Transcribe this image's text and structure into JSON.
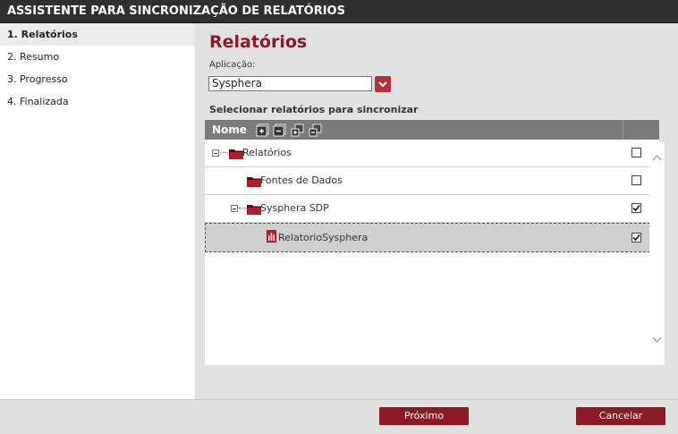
{
  "window": {
    "title": "ASSISTENTE PARA SINCRONIZAÇÃO DE RELATÓRIOS"
  },
  "steps": [
    {
      "label": "1. Relatórios",
      "active": true
    },
    {
      "label": "2. Resumo",
      "active": false
    },
    {
      "label": "3. Progresso",
      "active": false
    },
    {
      "label": "4. Finalizada",
      "active": false
    }
  ],
  "main": {
    "heading": "Relatórios",
    "application_label": "Aplicação:",
    "application_value": "Sysphera",
    "select_label": "Selecionar relatórios para sincronizar"
  },
  "grid": {
    "column_name": "Nome",
    "rows": [
      {
        "label": "Relatórios",
        "type": "folder",
        "checked": false
      },
      {
        "label": "Fontes de Dados",
        "type": "folder",
        "checked": false
      },
      {
        "label": "Sysphera SDP",
        "type": "folder",
        "checked": true
      },
      {
        "label": "RelatorioSysphera",
        "type": "report",
        "checked": true
      }
    ]
  },
  "buttons": {
    "next": "Próximo",
    "cancel": "Cancelar"
  },
  "colors": {
    "accent": "#8b1a24",
    "titlebar": "#2f2f2f",
    "grid_header": "#7b7b7b"
  }
}
